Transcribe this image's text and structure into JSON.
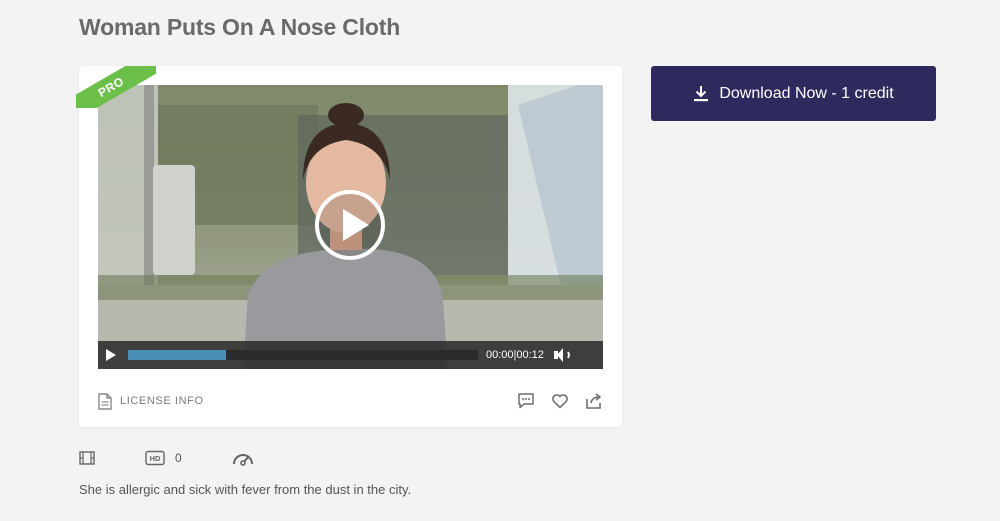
{
  "page": {
    "title": "Woman Puts On A Nose Cloth"
  },
  "badge": {
    "pro_label": "PRO"
  },
  "player": {
    "current_time": "00:00",
    "separator": "|",
    "duration": "00:12",
    "progress": 0.28
  },
  "card_footer": {
    "license_label": "LICENSE INFO",
    "icons": [
      "comment-icon",
      "heart-icon",
      "share-icon"
    ]
  },
  "download": {
    "label": "Download Now - 1 credit",
    "icon": "download-icon"
  },
  "meta": {
    "hd_count": "0",
    "icons": [
      "film-icon",
      "hd-icon",
      "speedometer-icon"
    ]
  },
  "description": "She is allergic and sick with fever from the dust in the city.",
  "colors": {
    "download_bg": "#2e2a5e",
    "pro_green": "#6cc04a",
    "progress_fill": "#4b8eb5",
    "page_bg": "#f3f3f3"
  }
}
